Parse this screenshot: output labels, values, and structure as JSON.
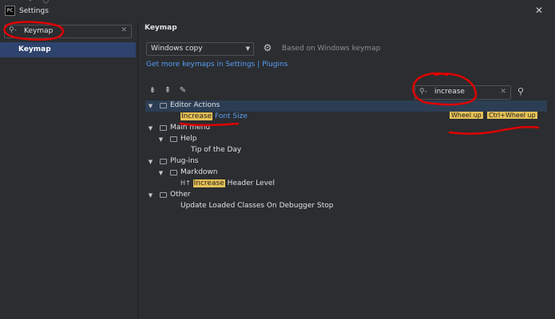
{
  "window": {
    "title": "Settings",
    "app_icon": "PC"
  },
  "sidebar": {
    "search": {
      "value": "Keymap"
    },
    "items": [
      {
        "label": "Keymap",
        "selected": true
      }
    ]
  },
  "main": {
    "heading": "Keymap",
    "keymap_select": {
      "value": "Windows copy"
    },
    "based_on": "Based on Windows keymap",
    "links": {
      "prefix": "Get more keymaps in Settings",
      "separator": "|",
      "plugins": "Plugins"
    },
    "search": {
      "value": "increase"
    },
    "tree": [
      {
        "label": "Editor Actions",
        "expanded": true
      },
      {
        "label_highlight": "Increase",
        "label_rest": "Font Size",
        "shortcuts": [
          "Wheel up",
          "Ctrl+Wheel up"
        ]
      },
      {
        "label": "Main menu",
        "expanded": true
      },
      {
        "label": "Help",
        "expanded": true
      },
      {
        "label": "Tip of the Day"
      },
      {
        "label": "Plug-ins",
        "expanded": true
      },
      {
        "label": "Markdown",
        "expanded": true
      },
      {
        "icon_text": "H↑",
        "label_highlight": "Increase",
        "label_rest": "Header Level"
      },
      {
        "label": "Other",
        "expanded": true
      },
      {
        "label": "Update Loaded Classes On Debugger Stop"
      }
    ]
  },
  "colors": {
    "background": "#2b2d30",
    "selection": "#2e436e",
    "link": "#589df6",
    "highlight": "#e6c156",
    "annotation": "#e00000"
  },
  "icons": [
    "search-icon",
    "clear-icon",
    "gear-icon",
    "expand-all-icon",
    "collapse-all-icon",
    "edit-icon",
    "find-shortcut-icon",
    "close-icon",
    "chevron-down-icon",
    "folder-icon"
  ]
}
